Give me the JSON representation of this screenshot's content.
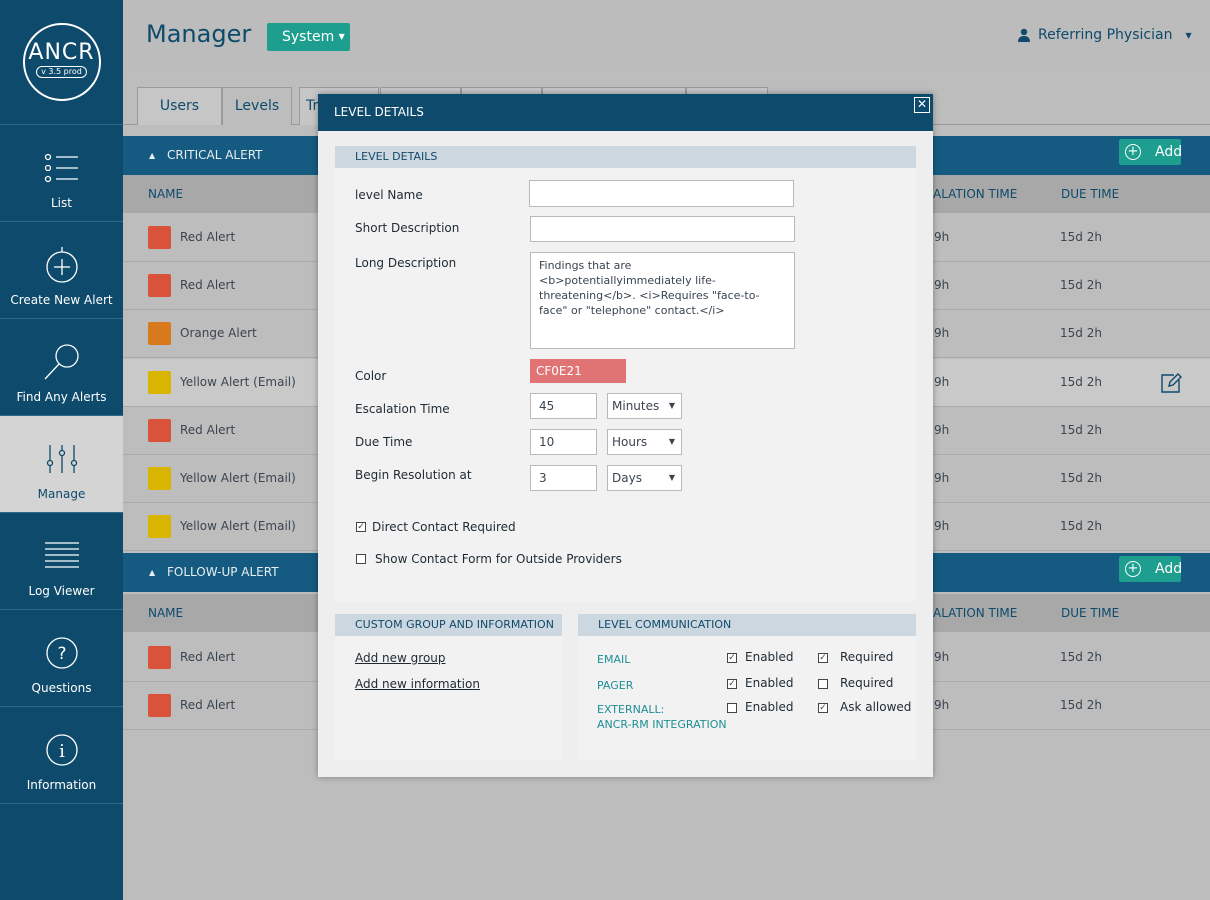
{
  "sidebar": {
    "logo": {
      "title": "ANCR",
      "version": "v 3.5 prod"
    },
    "items": [
      {
        "label": "List",
        "icon": "list-icon"
      },
      {
        "label": "Create New Alert",
        "icon": "plus-circle-icon"
      },
      {
        "label": "Find Any Alerts",
        "icon": "search-icon"
      },
      {
        "label": "Manage",
        "icon": "sliders-icon"
      },
      {
        "label": "Log Viewer",
        "icon": "log-icon"
      },
      {
        "label": "Questions",
        "icon": "question-icon"
      },
      {
        "label": "Information",
        "icon": "info-icon"
      }
    ]
  },
  "header": {
    "title": "Manager",
    "system_label": "System",
    "user_label": "Referring Physician"
  },
  "tabs": [
    "Users",
    "Levels",
    "Tr"
  ],
  "sections": {
    "critical": {
      "title": "CRITICAL ALERT",
      "add_label": "Add",
      "columns": {
        "name": "NAME",
        "escalation": "ALATION TIME",
        "due": "DUE TIME"
      },
      "rows": [
        {
          "name": "Red Alert",
          "color": "#d9533a",
          "escalation": "9h",
          "due": "15d 2h"
        },
        {
          "name": "Red Alert",
          "color": "#d9533a",
          "escalation": "9h",
          "due": "15d 2h"
        },
        {
          "name": "Orange Alert",
          "color": "#d87a1c",
          "escalation": "9h",
          "due": "15d 2h"
        },
        {
          "name": "Yellow Alert (Email)",
          "color": "#d9b400",
          "escalation": "9h",
          "due": "15d 2h"
        },
        {
          "name": "Red Alert",
          "color": "#d9533a",
          "escalation": "9h",
          "due": "15d 2h"
        },
        {
          "name": "Yellow Alert (Email)",
          "color": "#d9b400",
          "escalation": "9h",
          "due": "15d 2h"
        },
        {
          "name": "Yellow Alert (Email)",
          "color": "#d9b400",
          "escalation": "9h",
          "due": "15d 2h"
        }
      ]
    },
    "followup": {
      "title": "FOLLOW-UP ALERT",
      "add_label": "Add",
      "columns": {
        "name": "NAME",
        "escalation": "ALATION TIME",
        "due": "DUE TIME"
      },
      "rows": [
        {
          "name": "Red Alert",
          "color": "#d9533a",
          "escalation": "9h",
          "due": "15d 2h"
        },
        {
          "name": "Red Alert",
          "color": "#d9533a",
          "escalation": "9h",
          "due": "15d 2h"
        }
      ]
    }
  },
  "dialog": {
    "title": "LEVEL DETAILS",
    "details_head": "LEVEL DETAILS",
    "fields": {
      "level_name_label": "level Name",
      "level_name_value": "",
      "short_desc_label": "Short Description",
      "short_desc_value": "",
      "long_desc_label": "Long Description",
      "long_desc_value": "Findings that are <b>potentiallyimmediately life-threatening</b>.  <i>Requires \"face-to-face\" or \"telephone\" contact.</i>",
      "color_label": "Color",
      "color_value": "CF0E21",
      "escalation_label": "Escalation Time",
      "escalation_value": "45",
      "escalation_unit": "Minutes",
      "due_label": "Due Time",
      "due_value": "10",
      "due_unit": "Hours",
      "begin_label": "Begin Resolution at",
      "begin_value": "3",
      "begin_unit": "Days",
      "direct_contact_label": "Direct Contact Required",
      "direct_contact_checked": true,
      "show_contact_label": "Show Contact Form for Outside Providers",
      "show_contact_checked": false
    },
    "custom": {
      "head": "CUSTOM GROUP AND INFORMATION",
      "add_group": "Add new group",
      "add_info": "Add new information"
    },
    "communication": {
      "head": "LEVEL COMMUNICATION",
      "rows": [
        {
          "label": "EMAIL",
          "opt1": "Enabled",
          "opt1_checked": true,
          "opt2": "Required",
          "opt2_checked": true
        },
        {
          "label": "PAGER",
          "opt1": "Enabled",
          "opt1_checked": true,
          "opt2": "Required",
          "opt2_checked": false
        },
        {
          "label": "EXTERNALL:\nANCR-RM INTEGRATION",
          "opt1": "Enabled",
          "opt1_checked": false,
          "opt2": "Ask allowed",
          "opt2_checked": true
        }
      ]
    }
  }
}
